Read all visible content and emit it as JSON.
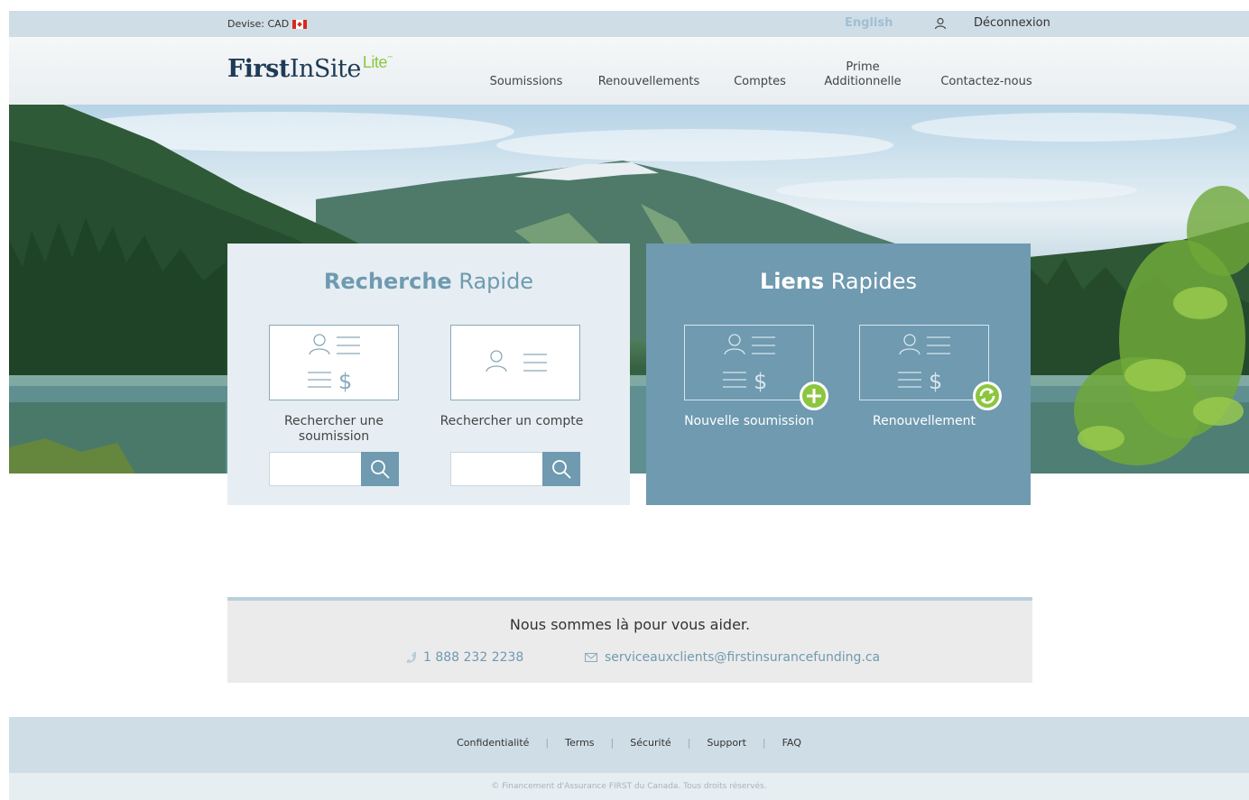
{
  "topbar": {
    "currency": "Devise: CAD",
    "language": "English",
    "logout": "Déconnexion"
  },
  "logo": {
    "first": "First",
    "insite": "InSite",
    "lite": "Lite",
    "tm": "™"
  },
  "nav": {
    "items": [
      {
        "label": "Soumissions"
      },
      {
        "label": "Renouvellements"
      },
      {
        "label": "Comptes"
      },
      {
        "label": "Prime Additionnelle"
      },
      {
        "label": "Contactez-nous"
      }
    ]
  },
  "search_panel": {
    "title_bold": "Recherche",
    "title_rest": " Rapide",
    "cards": [
      {
        "label": "Rechercher une soumission",
        "value": ""
      },
      {
        "label": "Rechercher un compte",
        "value": ""
      }
    ]
  },
  "links_panel": {
    "title_bold": "Liens",
    "title_rest": " Rapides",
    "cards": [
      {
        "label": "Nouvelle soumission"
      },
      {
        "label": "Renouvellement"
      }
    ]
  },
  "help": {
    "title": "Nous sommes là pour vous aider.",
    "phone": "1 888 232 2238",
    "email": "serviceauxclients@firstinsurancefunding.ca"
  },
  "footer": {
    "links": [
      "Confidentialité",
      "Terms",
      "Sécurité",
      "Support",
      "FAQ"
    ],
    "copyright": "© Financement d'Assurance FIRST du Canada. Tous droits réservés."
  },
  "colors": {
    "accent": "#6f9ab0",
    "green": "#8cc63f",
    "navy": "#1e3a55",
    "topbar": "#cfdde6"
  }
}
